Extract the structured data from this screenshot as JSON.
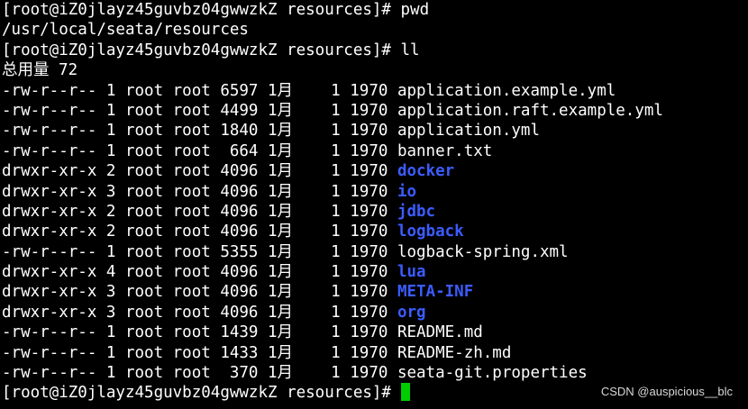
{
  "terminal": {
    "prompt": "[root@iZ0jlayz45guvbz04gwwzkZ resources]# ",
    "cmd_pwd": "pwd",
    "pwd_output": "/usr/local/seata/resources",
    "cmd_ll": "ll",
    "total": "总用量 72",
    "entries": [
      {
        "meta": "-rw-r--r-- 1 root root 6597 1月    1 1970 ",
        "name": "application.example.yml",
        "is_dir": false
      },
      {
        "meta": "-rw-r--r-- 1 root root 4499 1月    1 1970 ",
        "name": "application.raft.example.yml",
        "is_dir": false
      },
      {
        "meta": "-rw-r--r-- 1 root root 1840 1月    1 1970 ",
        "name": "application.yml",
        "is_dir": false
      },
      {
        "meta": "-rw-r--r-- 1 root root  664 1月    1 1970 ",
        "name": "banner.txt",
        "is_dir": false
      },
      {
        "meta": "drwxr-xr-x 2 root root 4096 1月    1 1970 ",
        "name": "docker",
        "is_dir": true
      },
      {
        "meta": "drwxr-xr-x 3 root root 4096 1月    1 1970 ",
        "name": "io",
        "is_dir": true
      },
      {
        "meta": "drwxr-xr-x 2 root root 4096 1月    1 1970 ",
        "name": "jdbc",
        "is_dir": true
      },
      {
        "meta": "drwxr-xr-x 2 root root 4096 1月    1 1970 ",
        "name": "logback",
        "is_dir": true
      },
      {
        "meta": "-rw-r--r-- 1 root root 5355 1月    1 1970 ",
        "name": "logback-spring.xml",
        "is_dir": false
      },
      {
        "meta": "drwxr-xr-x 4 root root 4096 1月    1 1970 ",
        "name": "lua",
        "is_dir": true
      },
      {
        "meta": "drwxr-xr-x 3 root root 4096 1月    1 1970 ",
        "name": "META-INF",
        "is_dir": true
      },
      {
        "meta": "drwxr-xr-x 3 root root 4096 1月    1 1970 ",
        "name": "org",
        "is_dir": true
      },
      {
        "meta": "-rw-r--r-- 1 root root 1439 1月    1 1970 ",
        "name": "README.md",
        "is_dir": false
      },
      {
        "meta": "-rw-r--r-- 1 root root 1433 1月    1 1970 ",
        "name": "README-zh.md",
        "is_dir": false
      },
      {
        "meta": "-rw-r--r-- 1 root root  370 1月    1 1970 ",
        "name": "seata-git.properties",
        "is_dir": false
      }
    ]
  },
  "colors": {
    "background": "#000000",
    "text": "#ffffff",
    "directory": "#3b5cff",
    "cursor": "#00cc00"
  },
  "watermark": "CSDN @auspicious__blc"
}
